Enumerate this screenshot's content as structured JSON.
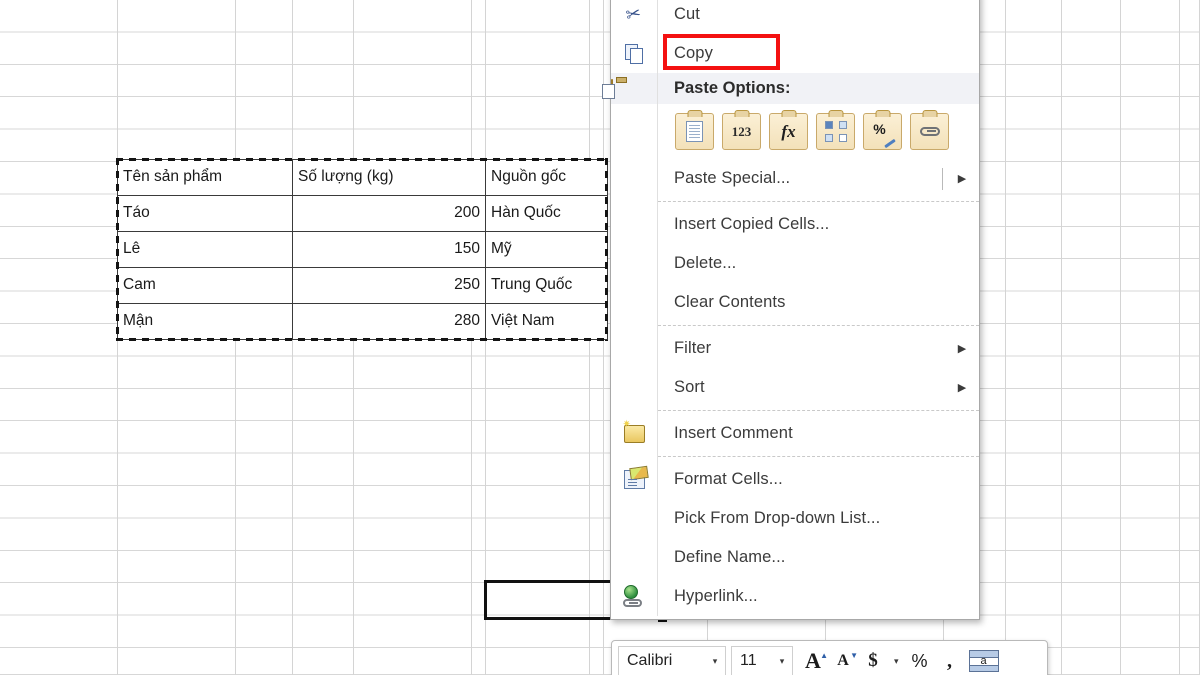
{
  "spreadsheet": {
    "table": {
      "headers": [
        "Tên sản phẩm",
        "Số lượng (kg)",
        "Nguồn gốc"
      ],
      "rows": [
        {
          "name": "Táo",
          "qty": "200",
          "origin": "Hàn Quốc"
        },
        {
          "name": "Lê",
          "qty": "150",
          "origin": "Mỹ"
        },
        {
          "name": "Cam",
          "qty": "250",
          "origin": "Trung Quốc"
        },
        {
          "name": "Mận",
          "qty": "280",
          "origin": "Việt Nam"
        }
      ]
    }
  },
  "context_menu": {
    "items": [
      {
        "label": "Cut",
        "icon": "scissors-icon"
      },
      {
        "label": "Copy",
        "icon": "copy-icon",
        "highlighted": true
      },
      {
        "label": "Paste Options:",
        "icon": "paste-icon",
        "header": true
      }
    ],
    "cut_label": "Cut",
    "copy_label": "Copy",
    "paste_options_label": "Paste Options:",
    "paste_special_label": "Paste Special...",
    "insert_copied_cells_label": "Insert Copied Cells...",
    "delete_label": "Delete...",
    "clear_contents_label": "Clear Contents",
    "filter_label": "Filter",
    "sort_label": "Sort",
    "insert_comment_label": "Insert Comment",
    "format_cells_label": "Format Cells...",
    "pick_from_list_label": "Pick From Drop-down List...",
    "define_name_label": "Define Name...",
    "hyperlink_label": "Hyperlink...",
    "submenu_arrow": "▶",
    "paste_option_icons": [
      "paste-all-icon",
      "paste-values-123-icon",
      "paste-formulas-fx-icon",
      "paste-transpose-icon",
      "paste-formatting-percent-icon",
      "paste-link-icon"
    ],
    "paste_values_glyph": "123",
    "paste_formulas_glyph": "fx",
    "paste_formatting_glyph": "%",
    "highlight_color": "#f41111"
  },
  "mini_toolbar": {
    "font_name": "Calibri",
    "font_size": "11",
    "grow_font_label": "A",
    "shrink_font_label": "A",
    "currency_label": "$",
    "percent_label": "%",
    "comma_label": ",",
    "number_format_label": "a",
    "caret_glyph": "▾"
  }
}
